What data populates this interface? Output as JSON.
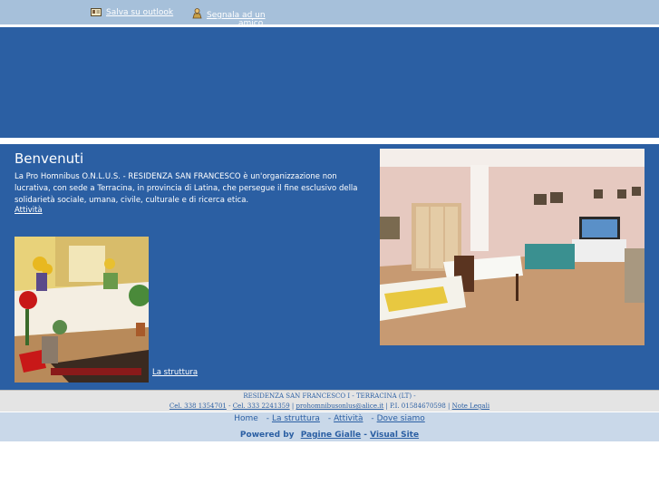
{
  "topbar": {
    "outlook_label": "Salva su outlook",
    "outlook_icon": "address-card-icon",
    "friend_label_1": "Segnala ad un",
    "friend_label_2": "amico",
    "friend_icon": "person-icon"
  },
  "main": {
    "title": "Benvenuti",
    "intro": "La Pro Homnibus O.N.L.U.S. - RESIDENZA SAN FRANCESCO è un'organizzazione non lucrativa, con sede a Terracina, in provincia di Latina, che persegue il fine esclusivo della solidarietà sociale, umana, civile, culturale e di ricerca etica.",
    "activity_link": "Attività",
    "structure_link": "La struttura"
  },
  "footer_info": {
    "line1": "RESIDENZA SAN FRANCESCO I - TERRACINA (LT) -",
    "phone1": "Cel. 338 1354701",
    "sep1": " - ",
    "phone2": "Cel. 333 2241359",
    "sep2": " | ",
    "email": "prohomnibusonlus@alice.it",
    "vat": " | P.I. 01584670598 | ",
    "legal": "Note Legali"
  },
  "footer_nav": {
    "home": "Home",
    "struttura": "La struttura",
    "attivita": "Attività",
    "dove": "Dove siamo",
    "powered_by": "Powered by",
    "pagine_gialle": "Pagine Gialle",
    "dash": "-",
    "visual_site": "Visual Site"
  },
  "colors": {
    "brand_blue": "#2b5fa3",
    "light_blue": "#a6c0da",
    "nav_bg": "#c9d8e9",
    "footer_grey": "#e4e4e4"
  }
}
